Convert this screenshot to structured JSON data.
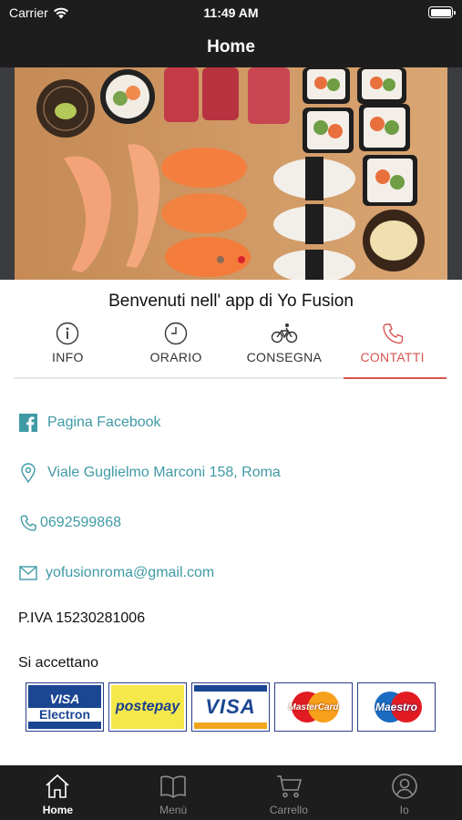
{
  "status_bar": {
    "carrier": "Carrier",
    "time": "11:49 AM",
    "battery_level": 1.0
  },
  "nav": {
    "title": "Home"
  },
  "carousel": {
    "page_count": 2,
    "active_index": 1
  },
  "welcome": "Benvenuti nell' app di Yo Fusion",
  "tabs": [
    {
      "label": "INFO",
      "icon": "info-icon",
      "active": false
    },
    {
      "label": "ORARIO",
      "icon": "clock-icon",
      "active": false
    },
    {
      "label": "CONSEGNA",
      "icon": "bicycle-icon",
      "active": false
    },
    {
      "label": "CONTATTI",
      "icon": "phone-icon",
      "active": true
    }
  ],
  "contacts": {
    "facebook": "Pagina Facebook",
    "address": "Viale Guglielmo Marconi 158, Roma",
    "phone": "0692599868",
    "email": "yofusionroma@gmail.com"
  },
  "piva": "P.IVA 15230281006",
  "payments": {
    "label": "Si accettano",
    "cards": [
      {
        "name": "visa-electron-card",
        "line1": "VISA",
        "line2": "Electron"
      },
      {
        "name": "postepay-card",
        "text": "postepay"
      },
      {
        "name": "visa-card",
        "text": "VISA"
      },
      {
        "name": "mastercard-card",
        "text": "MasterCard"
      },
      {
        "name": "maestro-card",
        "text": "Maestro"
      }
    ]
  },
  "tab_bar": [
    {
      "label": "Home",
      "icon": "home-icon",
      "active": true
    },
    {
      "label": "Menù",
      "icon": "book-icon",
      "active": false
    },
    {
      "label": "Carrello",
      "icon": "cart-icon",
      "active": false
    },
    {
      "label": "Io",
      "icon": "user-icon",
      "active": false
    }
  ],
  "colors": {
    "accent": "#d9534f",
    "link": "#3f9aa5",
    "bar": "#1d1d1d",
    "carousel_active": "#d9232d"
  }
}
